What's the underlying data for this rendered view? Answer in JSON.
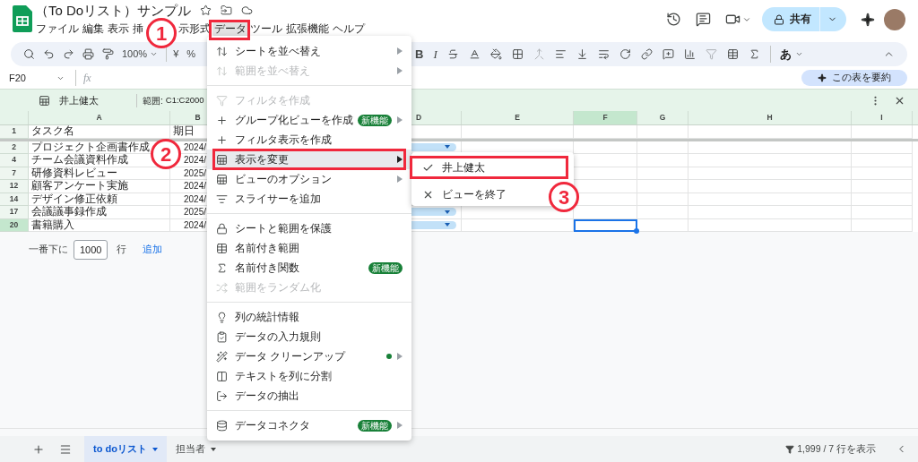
{
  "document": {
    "title": "（To Doリスト）サンプル"
  },
  "menu_bar": [
    {
      "label": "ファイル",
      "selected": false
    },
    {
      "label": "編集",
      "selected": false
    },
    {
      "label": "表示",
      "selected": false
    },
    {
      "label": "挿",
      "selected": false
    },
    {
      "label": "示形式",
      "selected": false
    },
    {
      "label": "データ",
      "selected": true
    },
    {
      "label": "ツール",
      "selected": false
    },
    {
      "label": "拡張機能",
      "selected": false
    },
    {
      "label": "ヘルプ",
      "selected": false
    }
  ],
  "share_button": "共有",
  "toolbar": {
    "zoom": "100%",
    "currency": "¥",
    "percent": "%",
    "bold": "B",
    "italic": "I",
    "input_tools": "あ"
  },
  "name_box": "F20",
  "formula_icon": "fx",
  "summarize_button": "この表を要約",
  "filter_view": {
    "name": "井上健太",
    "range_label": "範囲:",
    "range": "C1:C2000"
  },
  "columns": [
    {
      "label": "A",
      "selected": false
    },
    {
      "label": "B",
      "selected": false
    },
    {
      "label": "D",
      "selected": false
    },
    {
      "label": "E",
      "selected": false
    },
    {
      "label": "F",
      "selected": true
    },
    {
      "label": "G",
      "selected": false
    },
    {
      "label": "H",
      "selected": false
    },
    {
      "label": "I",
      "selected": false
    }
  ],
  "rows": [
    {
      "number": "1",
      "cells": [
        "タスク名",
        "期日"
      ],
      "selected": false
    },
    {
      "number": "2",
      "cells": [
        "プロジェクト企画書作成",
        "2024/"
      ],
      "dropdown": true,
      "selected": false
    },
    {
      "number": "4",
      "cells": [
        "チーム会議資料作成",
        "2024/"
      ],
      "selected": false
    },
    {
      "number": "7",
      "cells": [
        "研修資料レビュー",
        "2025/"
      ],
      "selected": false
    },
    {
      "number": "12",
      "cells": [
        "顧客アンケート実施",
        "2024/"
      ],
      "selected": false
    },
    {
      "number": "14",
      "cells": [
        "デザイン修正依頼",
        "2024/"
      ],
      "selected": false
    },
    {
      "number": "17",
      "cells": [
        "会議議事録作成",
        "2025/"
      ],
      "dropdown": true,
      "selected": false
    },
    {
      "number": "20",
      "cells": [
        "書籍購入",
        "2024/"
      ],
      "dropdown": true,
      "selected": true
    }
  ],
  "add_rows": {
    "prefix": "一番下に",
    "count": "1000",
    "suffix": "行",
    "button": "追加"
  },
  "data_menu": {
    "items": [
      {
        "kind": "item",
        "label": "シートを並べ替え",
        "disabled": false,
        "submenu": true,
        "highlighted": false,
        "dot": false
      },
      {
        "kind": "item",
        "label": "範囲を並べ替え",
        "disabled": true,
        "submenu": true,
        "highlighted": false,
        "dot": false
      },
      {
        "kind": "separator"
      },
      {
        "kind": "item",
        "label": "フィルタを作成",
        "disabled": true,
        "submenu": false,
        "highlighted": false,
        "dot": false
      },
      {
        "kind": "item",
        "label": "グループ化ビューを作成",
        "disabled": false,
        "submenu": true,
        "highlighted": false,
        "dot": false,
        "badge": "新機能"
      },
      {
        "kind": "item",
        "label": "フィルタ表示を作成",
        "disabled": false,
        "submenu": false,
        "highlighted": false,
        "dot": false
      },
      {
        "kind": "item",
        "label": "表示を変更",
        "disabled": false,
        "submenu": true,
        "highlighted": true,
        "dot": false
      },
      {
        "kind": "item",
        "label": "ビューのオプション",
        "disabled": false,
        "submenu": true,
        "highlighted": false,
        "dot": false
      },
      {
        "kind": "item",
        "label": "スライサーを追加",
        "disabled": false,
        "submenu": false,
        "highlighted": false,
        "dot": false
      },
      {
        "kind": "separator"
      },
      {
        "kind": "item",
        "label": "シートと範囲を保護",
        "disabled": false,
        "submenu": false,
        "highlighted": false,
        "dot": false
      },
      {
        "kind": "item",
        "label": "名前付き範囲",
        "disabled": false,
        "submenu": false,
        "highlighted": false,
        "dot": false
      },
      {
        "kind": "item",
        "label": "名前付き関数",
        "disabled": false,
        "submenu": false,
        "highlighted": false,
        "dot": false,
        "badge": "新機能"
      },
      {
        "kind": "item",
        "label": "範囲をランダム化",
        "disabled": true,
        "submenu": false,
        "highlighted": false,
        "dot": false
      },
      {
        "kind": "separator"
      },
      {
        "kind": "item",
        "label": "列の統計情報",
        "disabled": false,
        "submenu": false,
        "highlighted": false,
        "dot": false
      },
      {
        "kind": "item",
        "label": "データの入力規則",
        "disabled": false,
        "submenu": false,
        "highlighted": false,
        "dot": false
      },
      {
        "kind": "item",
        "label": "データ クリーンアップ",
        "disabled": false,
        "submenu": true,
        "highlighted": false,
        "dot": true
      },
      {
        "kind": "item",
        "label": "テキストを列に分割",
        "disabled": false,
        "submenu": false,
        "highlighted": false,
        "dot": false
      },
      {
        "kind": "item",
        "label": "データの抽出",
        "disabled": false,
        "submenu": false,
        "highlighted": false,
        "dot": false
      },
      {
        "kind": "separator"
      },
      {
        "kind": "item",
        "label": "データコネクタ",
        "disabled": false,
        "submenu": true,
        "highlighted": false,
        "dot": false,
        "badge": "新機能"
      }
    ]
  },
  "submenu": {
    "items": [
      {
        "kind": "check",
        "label": "井上健太",
        "checked": true
      },
      {
        "kind": "close",
        "label": "ビューを終了"
      }
    ]
  },
  "sheet_tabs": [
    {
      "label": "to doリスト",
      "selected": true
    },
    {
      "label": "担当者",
      "selected": false
    }
  ],
  "status": "1,999 / 7 行を表示",
  "annotations": [
    {
      "label": "1"
    },
    {
      "label": "2"
    },
    {
      "label": "3"
    }
  ]
}
